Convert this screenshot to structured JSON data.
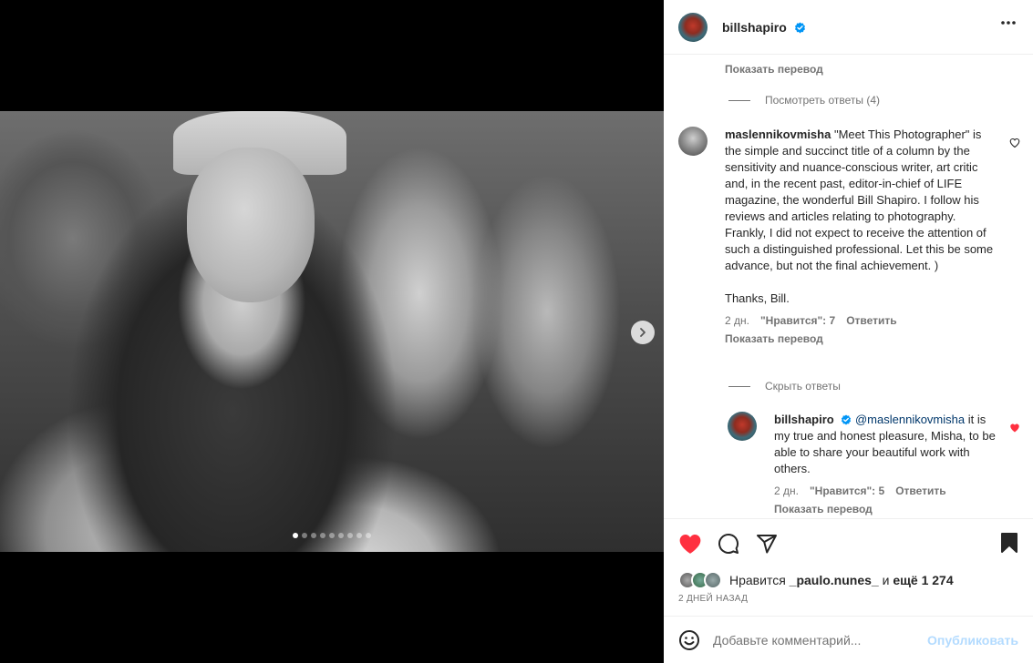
{
  "post": {
    "author": "billshapiro",
    "photo_count": 9,
    "active_photo_index": 0
  },
  "comments": {
    "translate_link_top": "Показать перевод",
    "view_replies": "Посмотреть ответы (4)",
    "comment1": {
      "username": "maslennikovmisha",
      "text": "\"Meet This Photographer\" is the simple and succinct title of a column by the sensitivity and nuance-conscious writer, art critic and, in the recent past, editor-in-chief of LIFE magazine, the wonderful Bill Shapiro. I follow his reviews and articles relating to photography. Frankly, I did not expect to receive the attention of such a distinguished professional. Let this be some advance, but not the final achievement. )",
      "text2": "Thanks, Bill.",
      "time": "2 дн.",
      "likes": "\"Нравится\": 7",
      "reply": "Ответить",
      "translate": "Показать перевод",
      "liked": false
    },
    "hide_replies": "Скрыть ответы",
    "reply1": {
      "username": "billshapiro",
      "mention": "@maslennikovmisha",
      "text": " it is my true and honest pleasure, Misha, to be able to share your beautiful work with others.",
      "time": "2 дн.",
      "likes": "\"Нравится\": 5",
      "reply": "Ответить",
      "translate": "Показать перевод",
      "liked": true
    }
  },
  "actions": {
    "liked": true,
    "likes_prefix": "Нравится",
    "likes_user": "_paulo.nunes_",
    "likes_and": "и",
    "likes_more": "ещё 1 274",
    "date": "2 ДНЕЙ НАЗАД"
  },
  "comment_box": {
    "placeholder": "Добавьте комментарий...",
    "publish": "Опубликовать"
  },
  "colors": {
    "like_red": "#ff3040",
    "verified_blue": "#0095f6",
    "publish_disabled": "#b3dbff"
  },
  "icons": {
    "verified": "verified-badge-icon",
    "more": "more-horizontal-icon",
    "next": "chevron-right-icon",
    "like": "heart-icon",
    "comment": "comment-icon",
    "share": "paper-plane-icon",
    "save": "bookmark-icon",
    "emoji": "emoji-icon"
  }
}
